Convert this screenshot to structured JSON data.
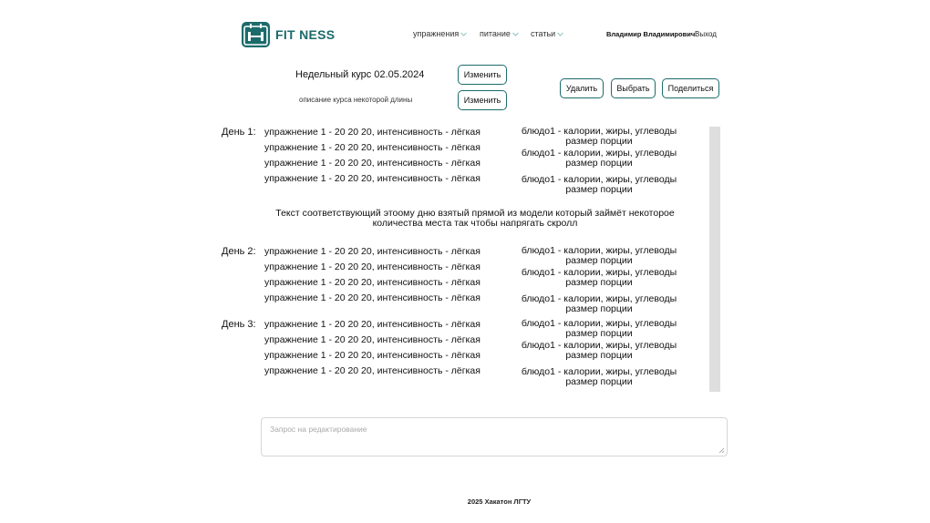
{
  "header": {
    "logo_text": "FIT NESS",
    "nav": [
      "упражнения",
      "питание",
      "статьи"
    ],
    "user_name": "Владимир Владимирович",
    "logout": "Выход"
  },
  "course": {
    "title": "Недельный курс 02.05.2024",
    "description": "описание курса некоторой длины",
    "edit_label": "Изменить",
    "delete_label": "Удалить",
    "select_label": "Выбрать",
    "share_label": "Поделиться"
  },
  "days": [
    {
      "label": "День 1:",
      "exercises": [
        "упражнение 1 - 20 20 20, интенсивность - лёгкая",
        "упражнение 1 - 20 20 20, интенсивность - лёгкая",
        "упражнение 1 - 20 20 20, интенсивность - лёгкая",
        "упражнение 1 - 20 20 20, интенсивность - лёгкая"
      ],
      "dishes": [
        {
          "line1": "блюдо1 - калории, жиры, углеводы",
          "line2": "размер порции"
        },
        {
          "line1": "блюдо1 - калории, жиры, углеводы",
          "line2": "размер порции"
        },
        {
          "line1": "блюдо1 - калории, жиры, углеводы",
          "line2": "размер порции"
        }
      ],
      "note_line1": "Текст соответствующий этоому дню взятый прямой из модели который займёт некоторое",
      "note_line2": "количества места так чтобы напрягать скролл"
    },
    {
      "label": "День 2:",
      "exercises": [
        "упражнение 1 - 20 20 20, интенсивность - лёгкая",
        "упражнение 1 - 20 20 20, интенсивность - лёгкая",
        "упражнение 1 - 20 20 20, интенсивность - лёгкая",
        "упражнение 1 - 20 20 20, интенсивность - лёгкая"
      ],
      "dishes": [
        {
          "line1": "блюдо1 - калории, жиры, углеводы",
          "line2": "размер порции"
        },
        {
          "line1": "блюдо1 - калории, жиры, углеводы",
          "line2": "размер порции"
        },
        {
          "line1": "блюдо1 - калории, жиры, углеводы",
          "line2": "размер порции"
        }
      ]
    },
    {
      "label": "День 3:",
      "exercises": [
        "упражнение 1 - 20 20 20, интенсивность - лёгкая",
        "упражнение 1 - 20 20 20, интенсивность - лёгкая",
        "упражнение 1 - 20 20 20, интенсивность - лёгкая",
        "упражнение 1 - 20 20 20, интенсивность - лёгкая"
      ],
      "dishes": [
        {
          "line1": "блюдо1 - калории, жиры, углеводы",
          "line2": "размер порции"
        },
        {
          "line1": "блюдо1 - калории, жиры, углеводы",
          "line2": "размер порции"
        },
        {
          "line1": "блюдо1 - калории, жиры, углеводы",
          "line2": "размер порции"
        }
      ]
    }
  ],
  "edit_request": {
    "placeholder": "Запрос на редактирование",
    "value": ""
  },
  "footer": "2025 Хакатон ЛГТУ",
  "colors": {
    "brand": "#1c6b6b",
    "button_border": "#1c6b6b",
    "scrollbar": "#dedede"
  },
  "icons": [
    "dumbbell-calendar-icon",
    "chevron-down-icon",
    "resize-grip-icon"
  ]
}
